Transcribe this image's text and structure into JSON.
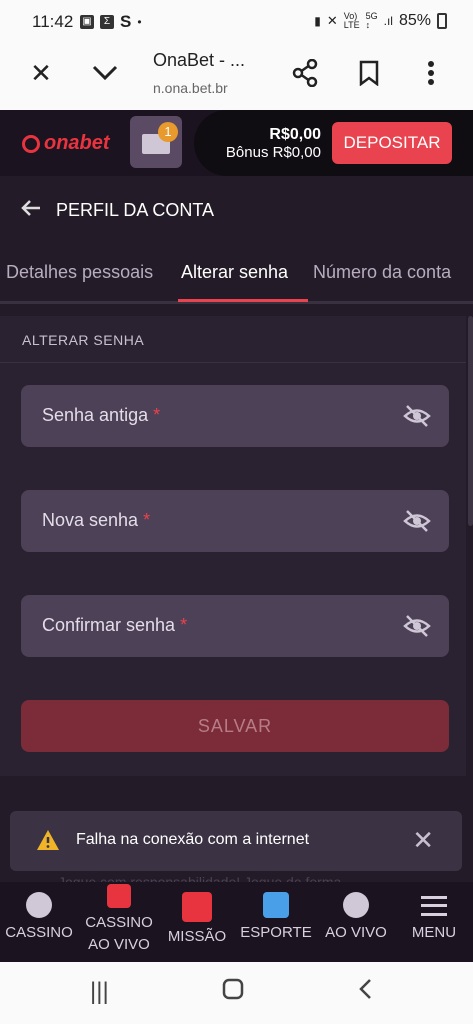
{
  "status_bar": {
    "time": "11:42",
    "battery": "85%"
  },
  "browser": {
    "title": "OnaBet - ...",
    "url": "n.ona.bet.br"
  },
  "header": {
    "logo_text": "onabet",
    "mail_badge": "1",
    "balance": "R$0,00",
    "bonus": "Bônus R$0,00",
    "deposit_label": "DEPOSITAR"
  },
  "page": {
    "title": "PERFIL DA CONTA"
  },
  "tabs": [
    {
      "label": "Detalhes pessoais"
    },
    {
      "label": "Alterar senha"
    },
    {
      "label": "Número da conta"
    }
  ],
  "form": {
    "section_label": "ALTERAR SENHA",
    "fields": [
      {
        "label": "Senha antiga",
        "required": "*"
      },
      {
        "label": "Nova senha",
        "required": "*"
      },
      {
        "label": "Confirmar senha",
        "required": "*"
      }
    ],
    "save_label": "SALVAR"
  },
  "toast": {
    "message": "Falha na conexão com a internet"
  },
  "partial_text": "Jogue com responsabilidade! Jogue de forma...",
  "bottom_nav": [
    {
      "label": "CASSINO"
    },
    {
      "label": "CASSINO AO VIVO"
    },
    {
      "label": "MISSÃO"
    },
    {
      "label": "ESPORTE"
    },
    {
      "label": "AO VIVO"
    },
    {
      "label": "MENU"
    }
  ],
  "colors": {
    "accent": "#e8434e",
    "background": "#231c28",
    "field": "#4c4156"
  }
}
